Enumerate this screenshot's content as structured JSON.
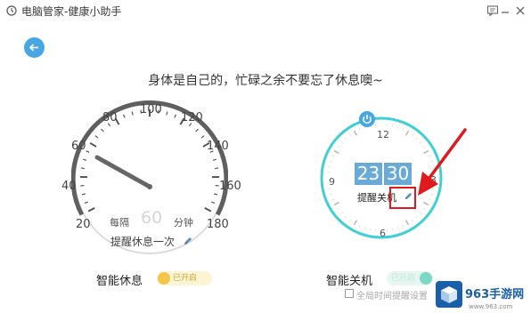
{
  "window": {
    "title": "电脑管家-健康小助手"
  },
  "main": {
    "slogan": "身体是自己的，忙碌之余不要忘了休息噢~"
  },
  "rest_gauge": {
    "ticks": [
      "20",
      "40",
      "60",
      "80",
      "100",
      "120",
      "140",
      "160",
      "180"
    ],
    "per_label": "每隔",
    "value": "60",
    "unit_label": "分钟",
    "remind_label": "提醒休息一次",
    "title": "智能休息",
    "toggle_label": "已开启"
  },
  "shutdown_clock": {
    "numbers": [
      "12",
      "3",
      "6",
      "9"
    ],
    "hour": "23",
    "minute": "30",
    "remind_label": "提醒关机",
    "title": "智能关机",
    "toggle_label": "已开启",
    "checkbox_label": "全局时间提醒设置"
  },
  "watermark": {
    "brand": "963手游网",
    "url": "www.963.com"
  },
  "colors": {
    "accent_blue": "#47a7e4",
    "clock_ring": "#40cfd2",
    "time_box": "#6aaad8",
    "rest_toggle": "#f2c64a",
    "shutdown_toggle": "#7ed8c6",
    "annotation_red": "#e0191c"
  },
  "icons": {
    "app": "clock-icon",
    "feedback": "chat-icon",
    "minimize": "minimize-icon",
    "close": "close-icon",
    "back": "back-arrow-icon",
    "edit": "pencil-icon",
    "power": "power-icon"
  }
}
